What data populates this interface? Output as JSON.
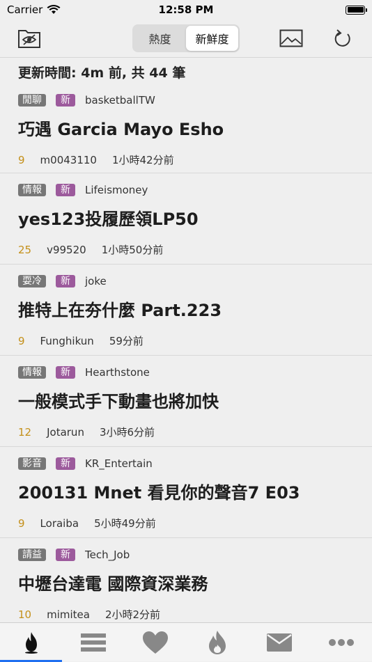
{
  "status": {
    "carrier": "Carrier",
    "time": "12:58 PM"
  },
  "nav": {
    "segments": [
      {
        "label": "熱度"
      },
      {
        "label": "新鮮度"
      }
    ],
    "active_segment": 1
  },
  "update_line": "更新時間: 4m 前, 共 44 筆",
  "posts": [
    {
      "category": "閒聊",
      "new_label": "新",
      "board": "basketballTW",
      "title": "巧遇 Garcia Mayo Esho",
      "count": "9",
      "author": "m0043110",
      "time": "1小時42分前"
    },
    {
      "category": "情報",
      "new_label": "新",
      "board": "Lifeismoney",
      "title": "yes123投履歷領LP50",
      "count": "25",
      "author": "v99520",
      "time": "1小時50分前"
    },
    {
      "category": "耍冷",
      "new_label": "新",
      "board": "joke",
      "title": "推特上在夯什麼 Part.223",
      "count": "9",
      "author": "Funghikun",
      "time": "59分前"
    },
    {
      "category": "情報",
      "new_label": "新",
      "board": "Hearthstone",
      "title": "一般模式手下動畫也將加快",
      "count": "12",
      "author": "Jotarun",
      "time": "3小時6分前"
    },
    {
      "category": "影音",
      "new_label": "新",
      "board": "KR_Entertain",
      "title": "200131 Mnet 看見你的聲音7 E03",
      "count": "9",
      "author": "Loraiba",
      "time": "5小時49分前"
    },
    {
      "category": "請益",
      "new_label": "新",
      "board": "Tech_Job",
      "title": "中壢台達電 國際資深業務",
      "count": "10",
      "author": "mimitea",
      "time": "2小時2分前"
    }
  ],
  "colors": {
    "accent": "#1f6ff0",
    "count": "#c4901a",
    "new_tag": "#9c5a9c",
    "category_tag": "#777777"
  },
  "tabs": [
    {
      "icon": "flame-icon",
      "active": true
    },
    {
      "icon": "list-icon",
      "active": false
    },
    {
      "icon": "heart-icon",
      "active": false
    },
    {
      "icon": "fire-drop-icon",
      "active": false
    },
    {
      "icon": "mail-icon",
      "active": false
    },
    {
      "icon": "more-icon",
      "active": false
    }
  ]
}
